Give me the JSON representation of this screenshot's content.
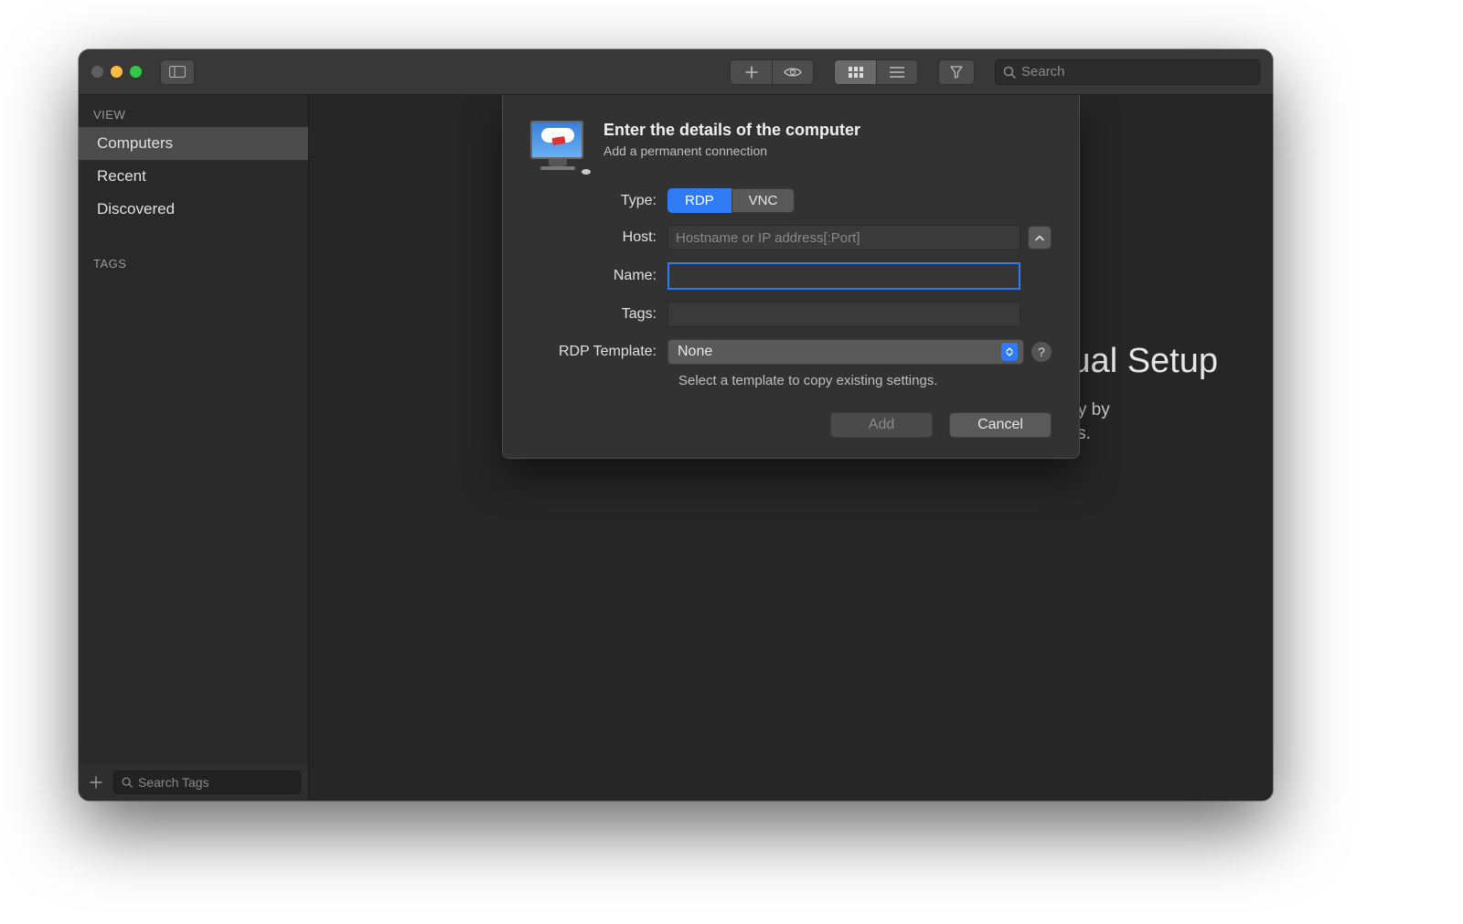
{
  "toolbar": {
    "search_placeholder": "Search"
  },
  "sidebar": {
    "sections": {
      "view_label": "VIEW",
      "tags_label": "TAGS"
    },
    "items": [
      {
        "label": "Computers"
      },
      {
        "label": "Recent"
      },
      {
        "label": "Discovered"
      }
    ],
    "tag_search_placeholder": "Search Tags"
  },
  "main": {
    "title_suffix": "ual Setup",
    "line1_suffix": "a computer manually by",
    "line2_suffix": "its network address."
  },
  "dialog": {
    "title": "Enter the details of the computer",
    "subtitle": "Add a permanent connection",
    "labels": {
      "type": "Type:",
      "host": "Host:",
      "name": "Name:",
      "tags": "Tags:",
      "template": "RDP Template:"
    },
    "type_options": {
      "rdp": "RDP",
      "vnc": "VNC"
    },
    "host_placeholder": "Hostname or IP address[:Port]",
    "name_value": "",
    "tags_value": "",
    "template_value": "None",
    "template_hint": "Select a template to copy existing settings.",
    "buttons": {
      "add": "Add",
      "cancel": "Cancel"
    }
  }
}
